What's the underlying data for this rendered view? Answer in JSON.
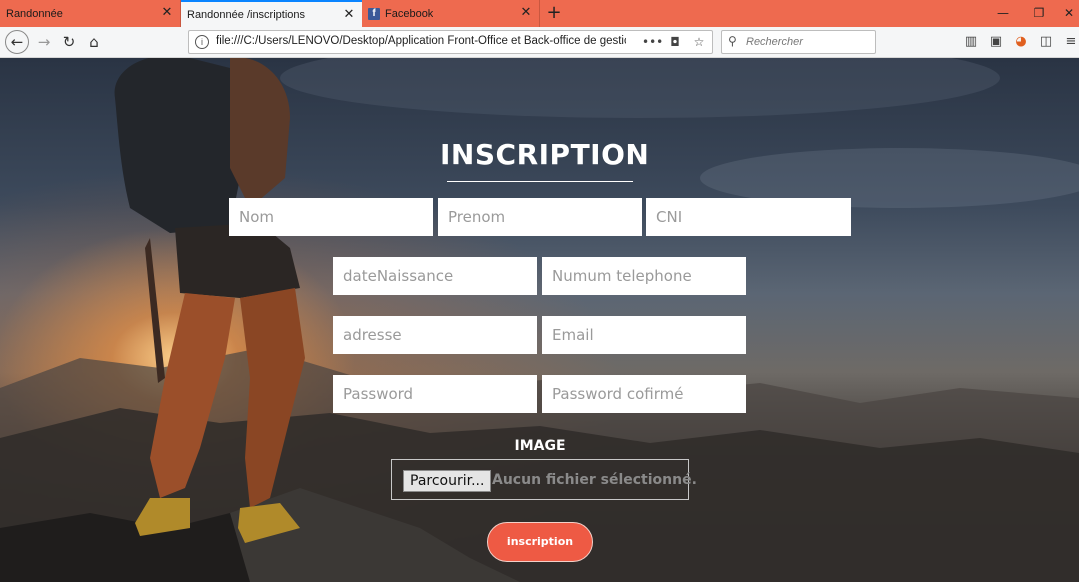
{
  "browser": {
    "tabs": [
      {
        "label": "Randonnée",
        "active": false
      },
      {
        "label": "Randonnée /inscriptions",
        "active": true
      },
      {
        "label": "Facebook",
        "active": false
      }
    ],
    "new_tab_glyph": "+",
    "window_controls": [
      "—",
      "❐",
      "✕"
    ],
    "url": "file:///C:/Users/LENOVO/Desktop/Application Front-Office et Back-office de gestion",
    "url_menu_glyph": "•••",
    "search": {
      "placeholder": "Rechercher"
    },
    "accent": "#ee6a4f",
    "active_tab_accent": "#0a84ff"
  },
  "form": {
    "title": "INSCRIPTION",
    "fields": {
      "nom": {
        "placeholder": "Nom",
        "value": ""
      },
      "prenom": {
        "placeholder": "Prenom",
        "value": ""
      },
      "cni": {
        "placeholder": "CNI",
        "value": ""
      },
      "date_naissance": {
        "placeholder": "dateNaissance",
        "value": ""
      },
      "telephone": {
        "placeholder": "Numum telephone",
        "value": ""
      },
      "adresse": {
        "placeholder": "adresse",
        "value": ""
      },
      "email": {
        "placeholder": "Email",
        "value": ""
      },
      "password": {
        "placeholder": "Password",
        "value": ""
      },
      "password_confirm": {
        "placeholder": "Password cofirmé",
        "value": ""
      }
    },
    "image_label": "IMAGE",
    "file_button_label": "Parcourir...",
    "file_status": "Aucun fichier sélectionné.",
    "submit_label": "inscription",
    "submit_color": "#ee5a44"
  }
}
